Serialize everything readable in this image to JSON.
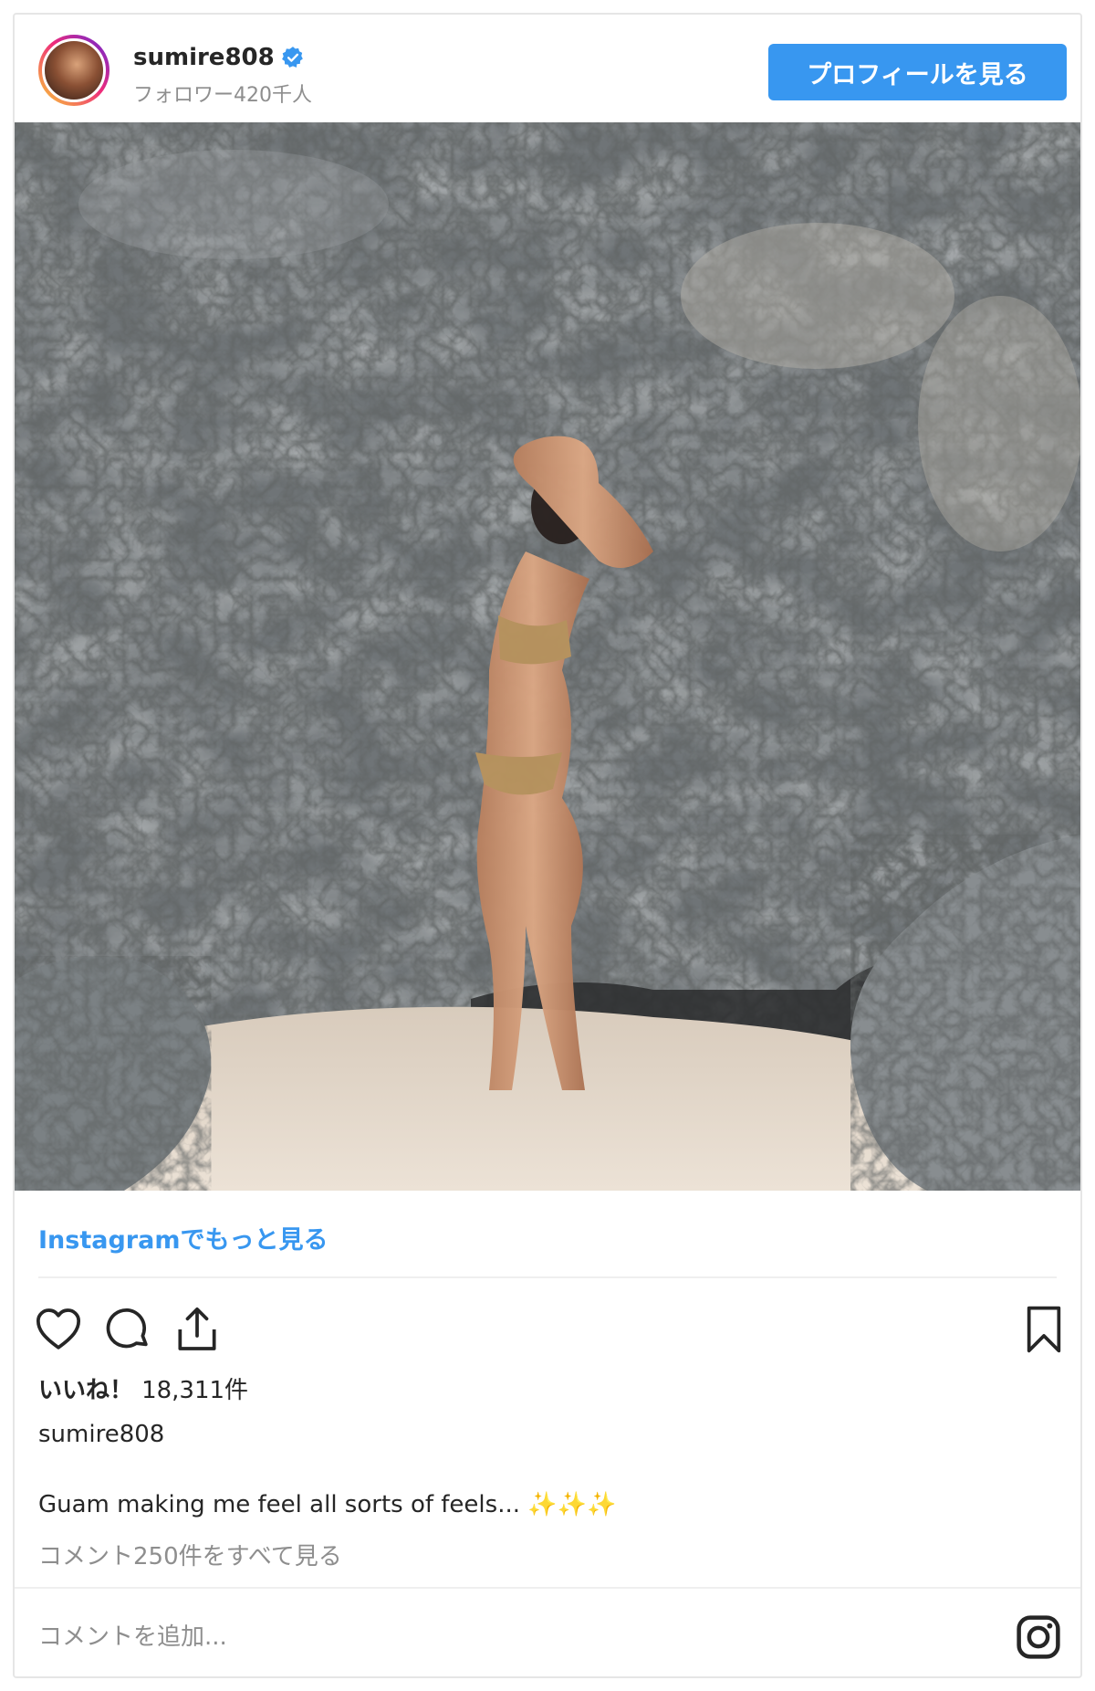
{
  "header": {
    "username": "sumire808",
    "followers": "フォロワー420千人",
    "profile_button": "プロフィールを見る",
    "verified_icon": "verified-badge-icon"
  },
  "post": {
    "more_link": "Instagramでもっと見る",
    "likes_label": "いいね！",
    "likes_count": "18,311件",
    "caption_user": "sumire808",
    "caption_text": "Guam making me feel all sorts of feels... ✨✨✨",
    "comments_link": "コメント250件をすべて見る",
    "comment_placeholder": "コメントを追加..."
  },
  "icons": [
    "heart-icon",
    "comment-icon",
    "share-icon",
    "bookmark-icon",
    "instagram-logo-icon"
  ],
  "colors": {
    "accent": "#3897f0",
    "text": "#262626",
    "muted": "#8e8e8e"
  }
}
